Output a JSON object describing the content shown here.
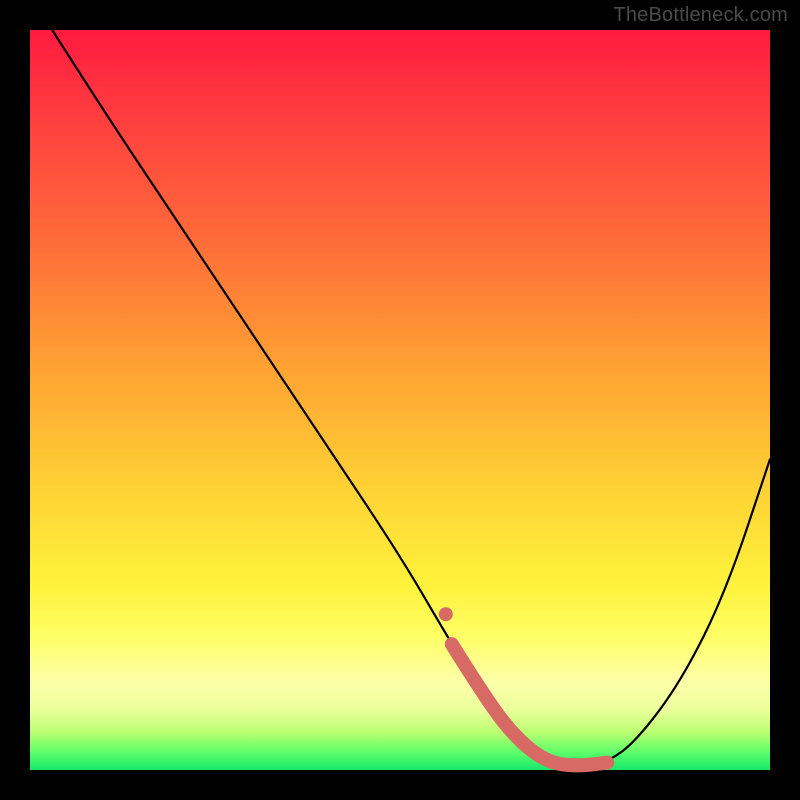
{
  "watermark": "TheBottleneck.com",
  "chart_data": {
    "type": "line",
    "title": "",
    "xlabel": "",
    "ylabel": "",
    "xlim": [
      0,
      100
    ],
    "ylim": [
      0,
      100
    ],
    "grid": false,
    "legend": false,
    "series": [
      {
        "name": "bottleneck-curve",
        "color": "#000000",
        "x": [
          3,
          10,
          20,
          30,
          40,
          50,
          57,
          62,
          66,
          70,
          74,
          78,
          82,
          88,
          94,
          100
        ],
        "y": [
          100,
          89,
          74,
          59,
          44,
          29,
          17,
          9,
          4,
          1,
          0.5,
          1,
          4,
          12,
          24,
          42
        ]
      }
    ],
    "highlight": {
      "name": "optimal-zone",
      "color": "#d86a66",
      "points_x": [
        57,
        62,
        66,
        70,
        74,
        78
      ],
      "points_y": [
        17,
        9,
        4,
        1,
        0.5,
        1
      ]
    }
  }
}
